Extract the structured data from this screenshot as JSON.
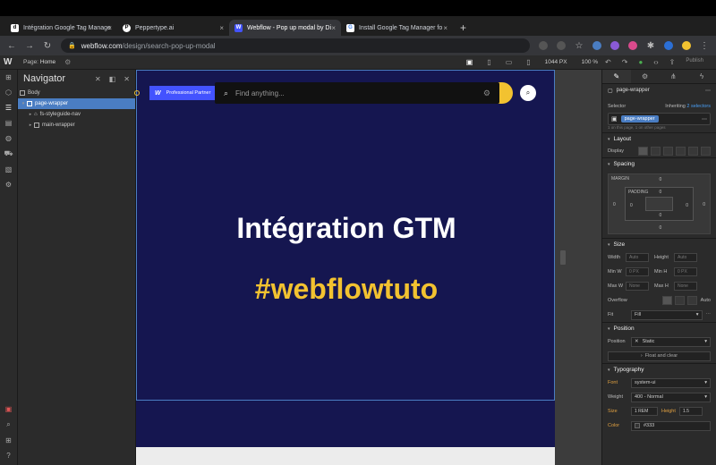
{
  "browser": {
    "tabs": [
      {
        "label": "Intégration Google Tag Manage",
        "icon": "d",
        "color": "#ffffff"
      },
      {
        "label": "Peppertype.ai",
        "icon": "P",
        "color": "#ffffff"
      },
      {
        "label": "Webflow - Pop up modal by Di",
        "icon": "W",
        "color": "#4353ff"
      },
      {
        "label": "Install Google Tag Manager fo",
        "icon": "G",
        "color": "#ffffff"
      }
    ],
    "url_host": "webflow.com",
    "url_path": "/design/search-pop-up-modal"
  },
  "designer": {
    "logo": "W",
    "page_label": "Page:",
    "page_name": "Home",
    "width_readout": "1044 PX",
    "zoom": "100 %",
    "publish": "Publish"
  },
  "navigator": {
    "title": "Navigator",
    "tree": [
      {
        "label": "Body",
        "level": 0,
        "selected": false
      },
      {
        "label": "page-wrapper",
        "level": 1,
        "selected": true
      },
      {
        "label": "fs-styleguide-nav",
        "level": 2,
        "selected": false
      },
      {
        "label": "main-wrapper",
        "level": 2,
        "selected": false
      }
    ]
  },
  "canvas": {
    "partner_logo": "W",
    "partner_label": "Professional Partner",
    "search_placeholder": "Find anything...",
    "hero_title": "Intégration GTM",
    "hero_tag": "#webflowtuto",
    "colors": {
      "bg": "#151650",
      "accent": "#f2c230",
      "partner": "#4353ff"
    }
  },
  "style_panel": {
    "selector_label": "Selector",
    "inheriting": "Inheriting",
    "selectors_link": "2 selectors",
    "class_chip": "page-wrapper",
    "note": "1 on this page, 1 on other pages",
    "layout_head": "Layout",
    "display_label": "Display",
    "spacing_head": "Spacing",
    "margin_label": "MARGIN",
    "padding_label": "PADDING",
    "zero": "0",
    "size_head": "Size",
    "width_label": "Width",
    "height_label": "Height",
    "auto": "Auto",
    "minw_label": "Min W",
    "minh_label": "Min H",
    "px": "PX",
    "maxw_label": "Max W",
    "maxh_label": "Max H",
    "none": "None",
    "overflow_label": "Overflow",
    "fit_label": "Fit",
    "fit_value": "Fill",
    "position_head": "Position",
    "position_label": "Position",
    "position_value": "Static",
    "float_clear": "Float and clear",
    "typography_head": "Typography",
    "font_label": "Font",
    "font_value": "system-ui",
    "weight_label": "Weight",
    "weight_value": "400 - Normal",
    "size_label": "Size",
    "size_value": "1",
    "rem": "REM",
    "height_t_label": "Height",
    "line_height": "1.5",
    "color_label": "Color",
    "color_value": "#333"
  }
}
